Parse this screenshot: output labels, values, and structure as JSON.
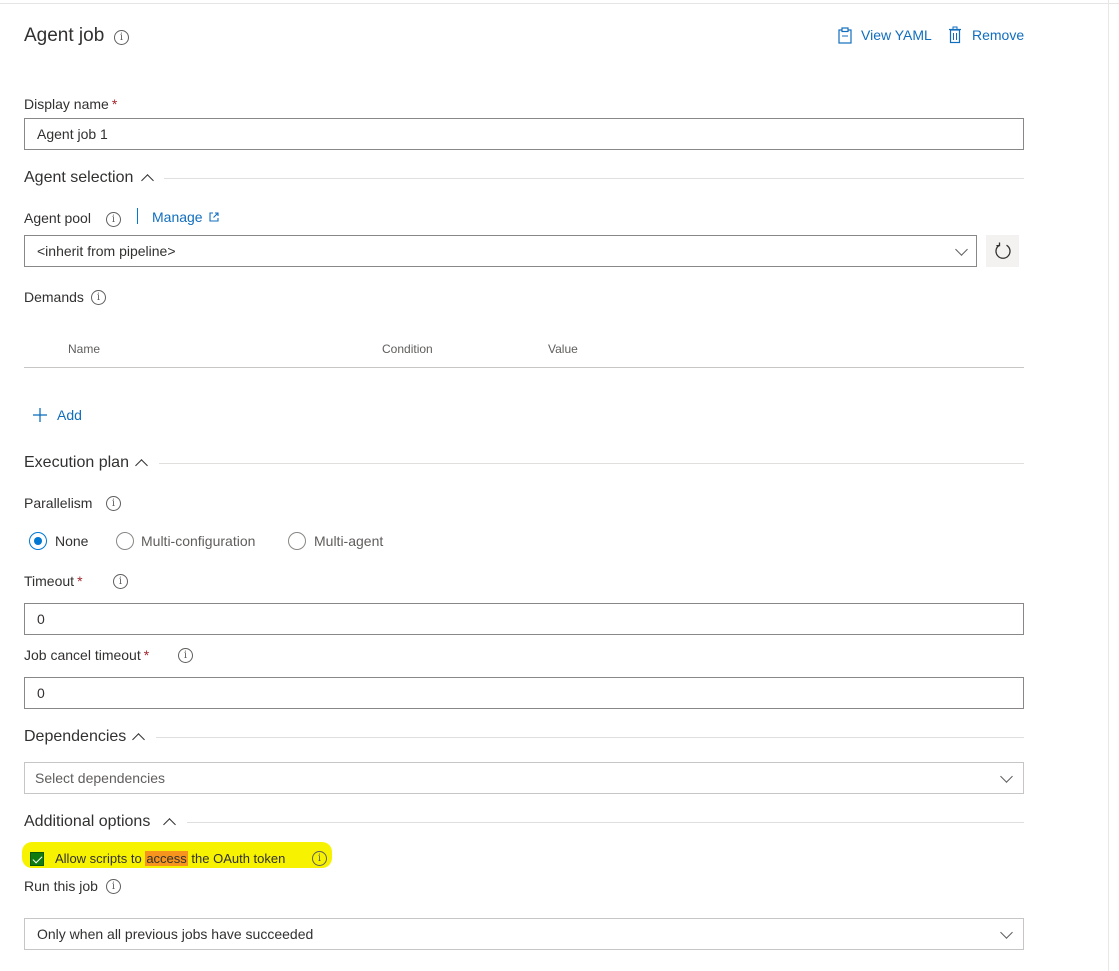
{
  "header": {
    "title": "Agent job",
    "view_yaml": "View YAML",
    "remove": "Remove"
  },
  "display_name": {
    "label": "Display name",
    "required": "*",
    "value": "Agent job 1"
  },
  "agent_selection": {
    "title": "Agent selection",
    "pool_label": "Agent pool",
    "manage": "Manage",
    "pool_value": "<inherit from pipeline>",
    "demands_label": "Demands",
    "columns": [
      "Name",
      "Condition",
      "Value"
    ],
    "add": "Add"
  },
  "execution_plan": {
    "title": "Execution plan",
    "parallelism_label": "Parallelism",
    "options": [
      "None",
      "Multi-configuration",
      "Multi-agent"
    ],
    "selected": "None",
    "timeout_label": "Timeout",
    "timeout_value": "0",
    "cancel_label": "Job cancel timeout",
    "cancel_value": "0"
  },
  "dependencies": {
    "title": "Dependencies",
    "placeholder": "Select dependencies"
  },
  "additional_options": {
    "title": "Additional options",
    "oauth_before": "Allow scripts to ",
    "oauth_mark": "access",
    "oauth_after": " the OAuth token",
    "oauth_checked": true,
    "run_label": "Run this job",
    "run_value": "Only when all previous jobs have succeeded"
  },
  "colors": {
    "accent": "#0078d4",
    "link": "#106ebe",
    "checkbox": "#107c10",
    "highlight": "#f7f200",
    "mark": "#f7941d"
  }
}
